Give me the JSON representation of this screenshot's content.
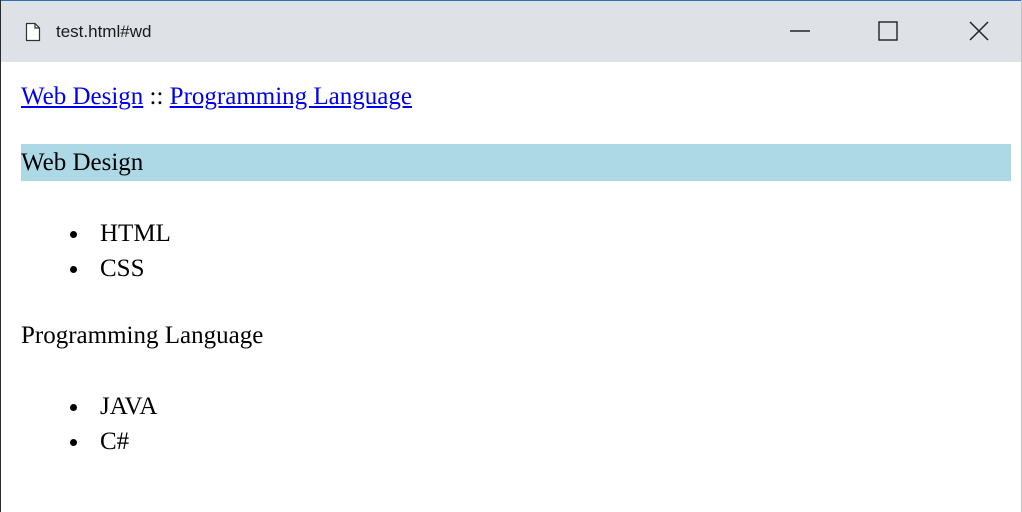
{
  "window": {
    "title": "test.html#wd",
    "icons": {
      "page": "page-icon",
      "minimize": "minimize-icon",
      "maximize": "maximize-icon",
      "close": "close-icon"
    }
  },
  "breadcrumb": {
    "link1": "Web Design",
    "separator": "::",
    "link2": "Programming Language"
  },
  "sections": {
    "web": {
      "heading": "Web Design",
      "items": [
        "HTML",
        "CSS"
      ],
      "highlight_color": "#add8e6"
    },
    "prog": {
      "heading": "Programming Language",
      "items": [
        "JAVA",
        "C#"
      ]
    }
  },
  "colors": {
    "link": "#0000ee",
    "titlebar": "#dee1e6"
  }
}
